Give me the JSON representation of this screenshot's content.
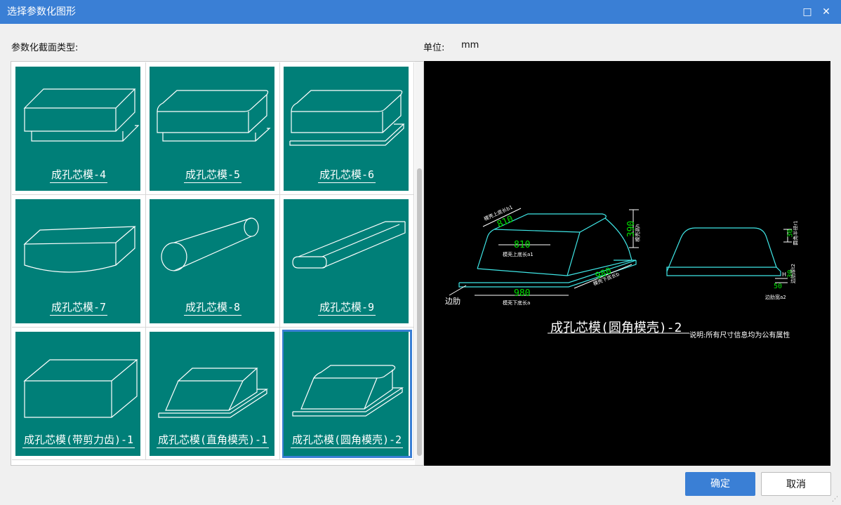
{
  "window": {
    "title": "选择参数化图形",
    "maximize_glyph": "□",
    "close_glyph": "✕"
  },
  "section_label": "参数化截面类型:",
  "unit": {
    "label": "单位:",
    "value": "mm"
  },
  "shapes": [
    {
      "label": "成孔芯模-4",
      "icon": "box-chamfered-icon"
    },
    {
      "label": "成孔芯模-5",
      "icon": "box-rounded-icon"
    },
    {
      "label": "成孔芯模-6",
      "icon": "box-flanged-icon"
    },
    {
      "label": "成孔芯模-7",
      "icon": "box-curved-icon"
    },
    {
      "label": "成孔芯模-8",
      "icon": "cylinder-icon"
    },
    {
      "label": "成孔芯模-9",
      "icon": "rounded-bar-icon"
    },
    {
      "label": "成孔芯模(带剪力齿)-1",
      "icon": "box-plain-icon"
    },
    {
      "label": "成孔芯模(直角模壳)-1",
      "icon": "trapezoid-shell-icon"
    },
    {
      "label": "成孔芯模(圆角模壳)-2",
      "icon": "rounded-shell-icon",
      "selected": true
    }
  ],
  "preview": {
    "title": "成孔芯模(圆角模壳)-2",
    "note": "说明:所有尺寸信息均为公有属性",
    "dims": {
      "top_length_b1": "810",
      "top_length_a1": "810",
      "bottom_length_a": "980",
      "bottom_length_b": "980",
      "height": "390",
      "fillet_r": "30",
      "rib_h": "30",
      "rib_w": "50"
    },
    "labels": {
      "top_b1": "模壳上底长b1",
      "top_a1": "模壳上底长a1",
      "bottom_a": "模壳下底长a",
      "bottom_b": "模壳下底长b",
      "height": "模壳高h",
      "fillet": "圆角半径r1",
      "rib_h": "边肋厚t2",
      "rib_w": "边肋宽a2",
      "flange": "边肋",
      "h_mark": "H"
    }
  },
  "buttons": {
    "ok": "确定",
    "cancel": "取消"
  },
  "colors": {
    "accent": "#3a7fd5",
    "tile": "#007f78",
    "cad_line": "#3fe6e6",
    "cad_dim": "#00e000"
  }
}
